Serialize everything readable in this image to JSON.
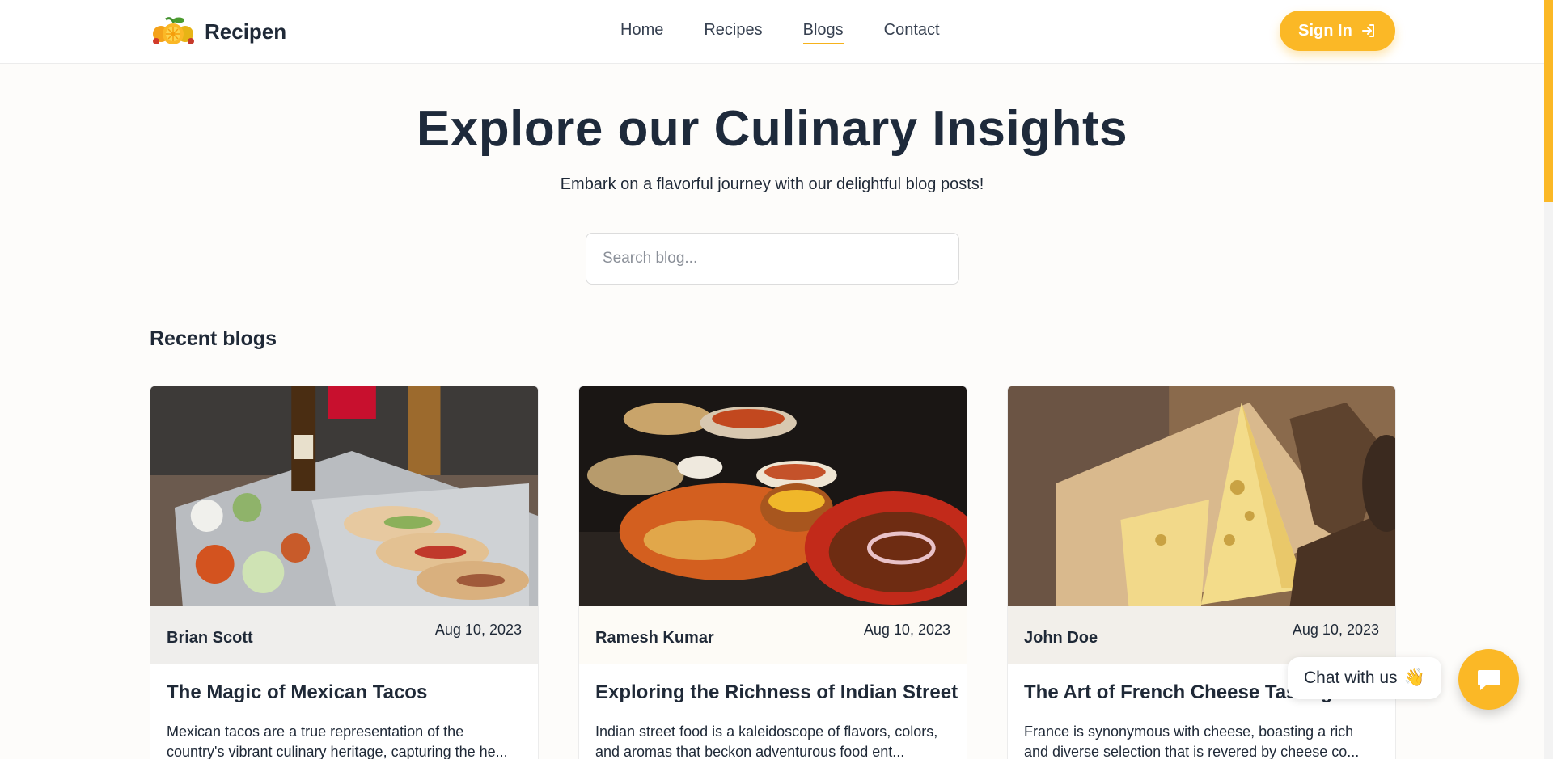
{
  "header": {
    "brand": "Recipen",
    "nav": [
      {
        "label": "Home",
        "active": false
      },
      {
        "label": "Recipes",
        "active": false
      },
      {
        "label": "Blogs",
        "active": true
      },
      {
        "label": "Contact",
        "active": false
      }
    ],
    "signin_label": "Sign In",
    "signin_icon": "sign-in-icon"
  },
  "hero": {
    "title": "Explore our Culinary Insights",
    "subtitle": "Embark on a flavorful journey with our delightful blog posts!"
  },
  "search": {
    "placeholder": "Search blog..."
  },
  "section_title": "Recent blogs",
  "cards": [
    {
      "author": "Brian Scott",
      "date": "Aug 10, 2023",
      "title": "The Magic of Mexican Tacos",
      "desc": "Mexican tacos are a true representation of the country's vibrant culinary heritage, capturing the he..."
    },
    {
      "author": "Ramesh Kumar",
      "date": "Aug 10, 2023",
      "title": "Exploring the Richness of Indian Street",
      "desc": "Indian street food is a kaleidoscope of flavors, colors, and aromas that beckon adventurous food ent..."
    },
    {
      "author": "John Doe",
      "date": "Aug 10, 2023",
      "title": "The Art of French Cheese Tasting",
      "desc": "France is synonymous with cheese, boasting a rich and diverse selection that is revered by cheese co..."
    }
  ],
  "chat": {
    "label": "Chat with us",
    "emoji": "👋",
    "button_icon": "chat-icon"
  },
  "colors": {
    "accent": "#fbb826",
    "text": "#1f2937",
    "background": "#fdfcfa"
  }
}
